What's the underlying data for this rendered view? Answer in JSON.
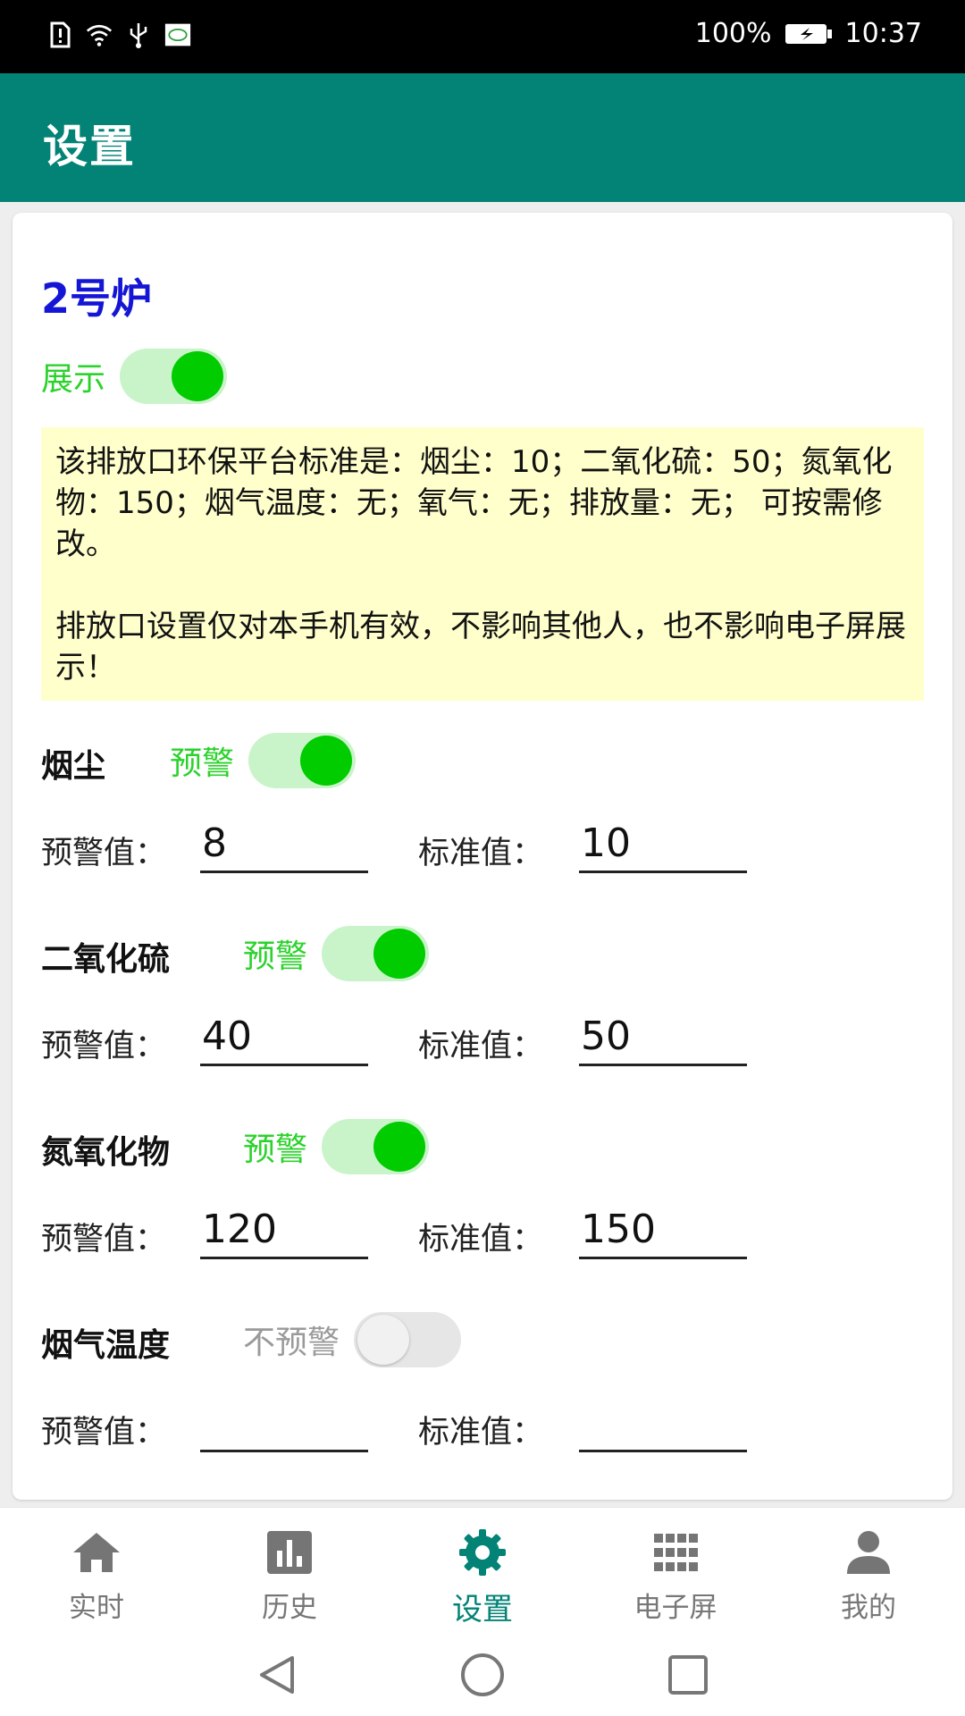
{
  "status_bar": {
    "battery": "100%",
    "time": "10:37"
  },
  "header": {
    "title": "设置"
  },
  "card": {
    "furnace": "2号炉",
    "show_label": "展示",
    "show_enabled": true,
    "notice_line1": "该排放口环保平台标准是：烟尘：10；二氧化硫：50；氮氧化物：150；烟气温度：无；氧气：无；排放量：无；  可按需修改。",
    "notice_line2": "排放口设置仅对本手机有效，不影响其他人，也不影响电子屏展示！",
    "pollutants": [
      {
        "name": "烟尘",
        "switch_label": "预警",
        "enabled": true,
        "warn_label": "预警值：",
        "warn_value": "8",
        "std_label": "标准值：",
        "std_value": "10"
      },
      {
        "name": "二氧化硫",
        "switch_label": "预警",
        "enabled": true,
        "warn_label": "预警值：",
        "warn_value": "40",
        "std_label": "标准值：",
        "std_value": "50"
      },
      {
        "name": "氮氧化物",
        "switch_label": "预警",
        "enabled": true,
        "warn_label": "预警值：",
        "warn_value": "120",
        "std_label": "标准值：",
        "std_value": "150"
      },
      {
        "name": "烟气温度",
        "switch_label": "不预警",
        "enabled": false,
        "warn_label": "预警值：",
        "warn_value": "",
        "std_label": "标准值：",
        "std_value": ""
      }
    ]
  },
  "bottom_nav": {
    "items": [
      {
        "label": "实时",
        "icon": "home-icon"
      },
      {
        "label": "历史",
        "icon": "bar-chart-icon"
      },
      {
        "label": "设置",
        "icon": "gear-icon"
      },
      {
        "label": "电子屏",
        "icon": "grid-icon"
      },
      {
        "label": "我的",
        "icon": "person-icon"
      }
    ],
    "active_index": 2
  },
  "colors": {
    "primary": "#028376",
    "furnace_title": "#1515d6",
    "switch_on": "#00cc00",
    "switch_label_on": "#2bd22b",
    "notice_bg": "#ffffcc"
  }
}
